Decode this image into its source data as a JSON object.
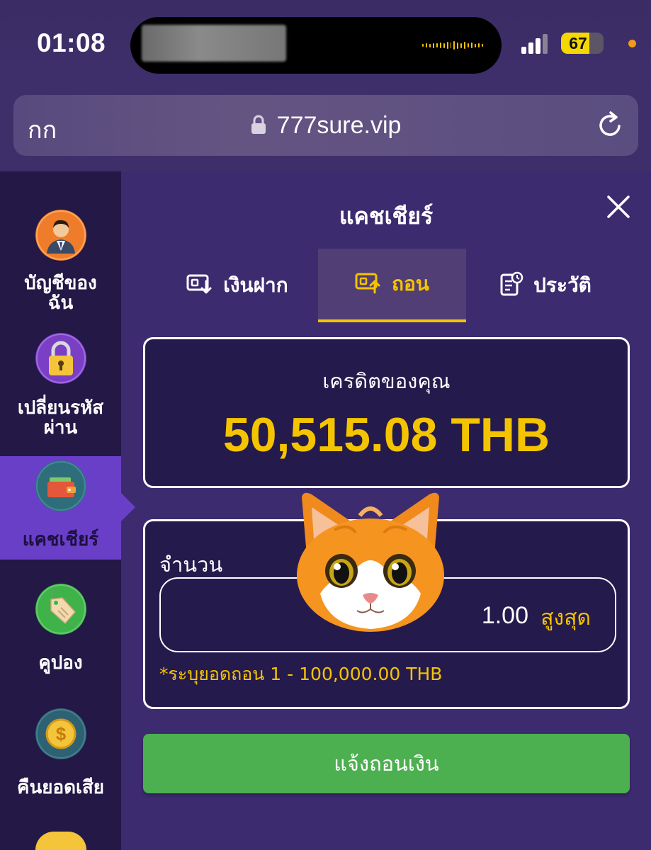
{
  "status_bar": {
    "time": "01:08",
    "battery_level": "67",
    "battery_fraction": 0.67,
    "colors": {
      "battery": "#f5d800",
      "privacy_dot": "#f39a1b"
    }
  },
  "browser": {
    "reader_label": "กก",
    "url": "777sure.vip",
    "icons": [
      "lock-icon",
      "reload-icon"
    ]
  },
  "sidebar": {
    "items": [
      {
        "label_line1": "บัญชีของ",
        "label_line2": "ฉัน",
        "icon": "user-avatar-icon"
      },
      {
        "label_line1": "เปลี่ยนรหัส",
        "label_line2": "ผ่าน",
        "icon": "padlock-icon"
      },
      {
        "label_line1": "แคชเชียร์",
        "label_line2": "",
        "icon": "wallet-icon",
        "active": true
      },
      {
        "label_line1": "คูปอง",
        "label_line2": "",
        "icon": "coupon-tag-icon"
      },
      {
        "label_line1": "คืนยอดเสีย",
        "label_line2": "",
        "icon": "dollar-coin-icon"
      }
    ]
  },
  "panel": {
    "title": "แคชเชียร์",
    "tabs": [
      {
        "label": "เงินฝาก",
        "icon": "deposit-icon"
      },
      {
        "label": "ถอน",
        "icon": "withdraw-icon",
        "active": true
      },
      {
        "label": "ประวัติ",
        "icon": "history-icon"
      }
    ],
    "credit": {
      "label": "เครดิตของคุณ",
      "value": "50,515.08 THB"
    },
    "amount": {
      "label": "จำนวน",
      "value": "1.00",
      "max_label": "สูงสุด",
      "hint": "*ระบุยอดถอน 1 - 100,000.00 THB"
    },
    "submit_label": "แจ้งถอนเงิน"
  },
  "colors": {
    "background": "#3d2b70",
    "sidebar": "#231846",
    "sidebar_active": "#6a3fc8",
    "accent": "#f5c400",
    "button": "#4caf50"
  }
}
